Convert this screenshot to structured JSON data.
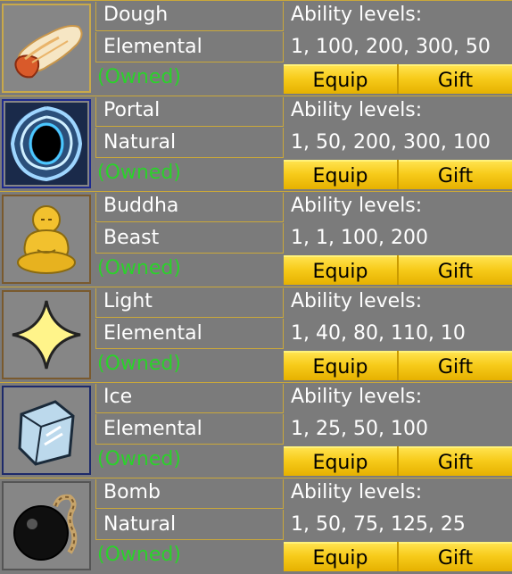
{
  "labels": {
    "ability_title": "Ability levels:",
    "owned": "(Owned)",
    "equip": "Equip",
    "gift": "Gift"
  },
  "fruits": [
    {
      "name": "Dough",
      "type": "Elemental",
      "levels": "1, 100, 200, 300, 50",
      "icon": "dough-fist-icon",
      "frame": "#c9a94a"
    },
    {
      "name": "Portal",
      "type": "Natural",
      "levels": "1, 50, 200, 300, 100",
      "icon": "portal-vortex-icon",
      "frame": "#1d2a8f"
    },
    {
      "name": "Buddha",
      "type": "Beast",
      "levels": "1, 1, 100, 200",
      "icon": "buddha-statue-icon",
      "frame": "#7a5a2e"
    },
    {
      "name": "Light",
      "type": "Elemental",
      "levels": "1, 40, 80, 110, 10",
      "icon": "light-star-icon",
      "frame": "#7a5a2e"
    },
    {
      "name": "Ice",
      "type": "Elemental",
      "levels": "1, 25, 50, 100",
      "icon": "ice-cube-icon",
      "frame": "#1d2a6a"
    },
    {
      "name": "Bomb",
      "type": "Natural",
      "levels": "1, 50, 75, 125, 25",
      "icon": "bomb-icon",
      "frame": "#555555"
    }
  ]
}
